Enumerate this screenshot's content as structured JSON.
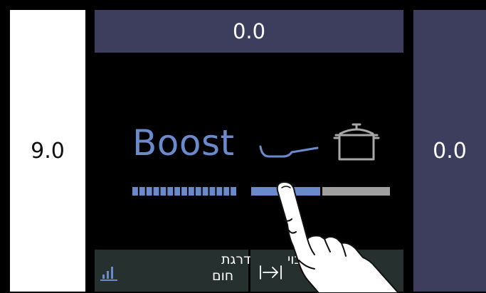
{
  "left_panel": {
    "value": "9.0"
  },
  "top_panel": {
    "value": "0.0"
  },
  "right_panel": {
    "value": "0.0"
  },
  "mode": {
    "label": "Boost",
    "level_segments": 15,
    "slider_fraction": 0.5,
    "icons": [
      "pan-icon",
      "pot-icon"
    ]
  },
  "buttons": {
    "heat": {
      "line1": "דרגת",
      "line2": "חום",
      "icon": "bar-levels-icon"
    },
    "transfer": {
      "line1": "בוי",
      "line2": "",
      "icon": "arrow-to-line-icon"
    }
  },
  "colors": {
    "panel_bg": "#3d3e5e",
    "accent_blue": "#6a8acb",
    "slider_rest": "#a0a0a0",
    "button_bg": "#26302e"
  }
}
